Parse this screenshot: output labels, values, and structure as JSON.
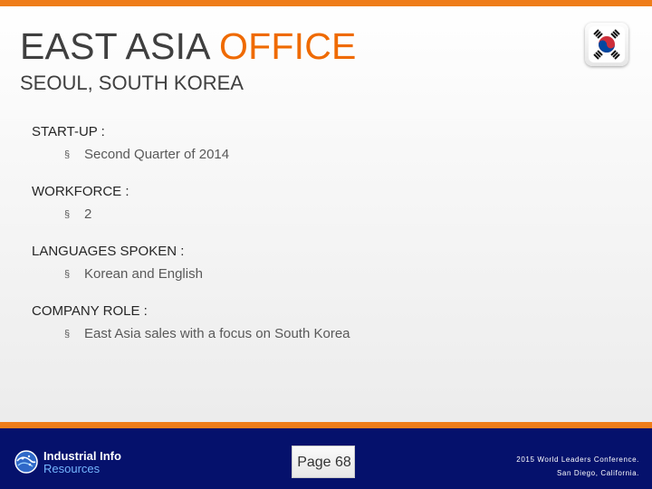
{
  "slide": {
    "title_main": "EAST ASIA",
    "title_accent": "OFFICE",
    "subtitle": "SEOUL, SOUTH KOREA",
    "flag_icon": "south-korea-flag-icon",
    "sections": [
      {
        "label": "START-UP :",
        "bullet": "Second Quarter of 2014"
      },
      {
        "label": "WORKFORCE :",
        "bullet": "2"
      },
      {
        "label": "LANGUAGES SPOKEN :",
        "bullet": "Korean and English"
      },
      {
        "label": "COMPANY ROLE :",
        "bullet": "East Asia sales with a focus on South Korea"
      }
    ],
    "bullet_mark": "§",
    "footer": {
      "brand_top": "Industrial Info",
      "brand_bottom": "Resources",
      "page_label": "Page 68",
      "event_line1": "2015 World Leaders Conference.",
      "event_line2": "San Diego, California."
    },
    "colors": {
      "accent": "#EF7D1A",
      "title_accent": "#EF6A00",
      "footer_bg": "#05116C"
    }
  }
}
